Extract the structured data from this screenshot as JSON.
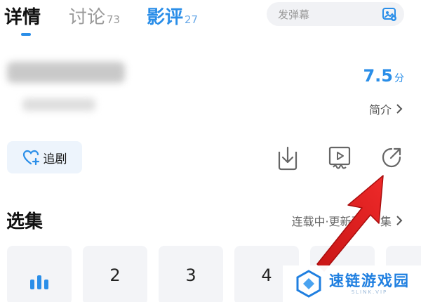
{
  "tabs": {
    "detail_label": "详情",
    "discuss_label": "讨论",
    "discuss_count": "73",
    "review_label": "影评",
    "review_count": "27"
  },
  "danmu": {
    "placeholder": "发弹幕"
  },
  "show": {
    "score_value": "7.5",
    "score_unit": "分",
    "intro_label": "简介"
  },
  "actions": {
    "follow_label": "追剧"
  },
  "episodes": {
    "title": "选集",
    "more_label": "连载中·更新至",
    "more_suffix": "集",
    "items": [
      "2",
      "3",
      "4"
    ]
  },
  "watermark": {
    "main": "速链游戏园",
    "sub": "SLINK.VIP"
  },
  "colors": {
    "accent": "#2a8ee8",
    "annotation_arrow": "#e02020"
  },
  "icons": [
    "image-icon",
    "heart-plus-icon",
    "download-icon",
    "screen-cast-icon",
    "share-icon",
    "chevron-right-icon",
    "playing-bars-icon"
  ]
}
